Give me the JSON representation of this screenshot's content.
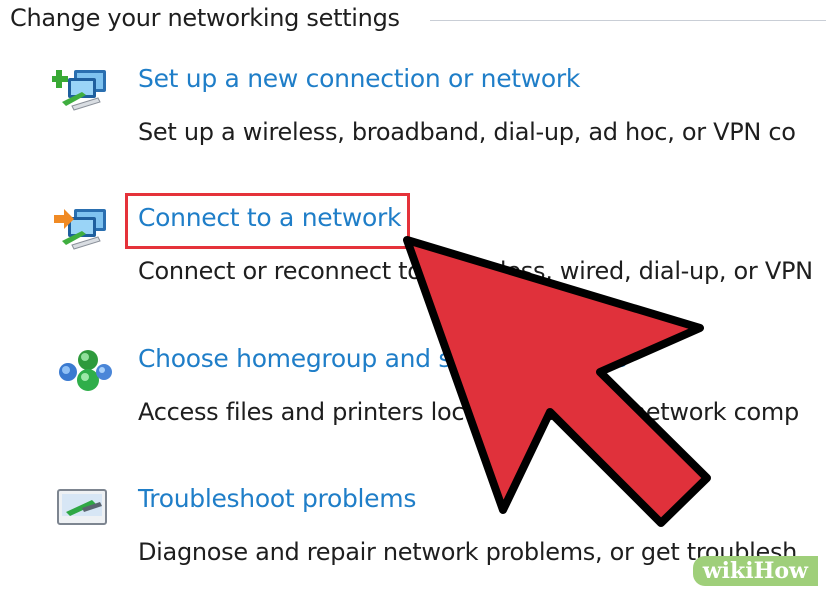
{
  "section": {
    "title": "Change your networking settings"
  },
  "tasks": [
    {
      "link": "Set up a new connection or network",
      "desc": "Set up a wireless, broadband, dial-up, ad hoc, or VPN co",
      "icon": "new-connection-icon"
    },
    {
      "link": "Connect to a network",
      "desc": "Connect or reconnect to a wireless, wired, dial-up, or VPN",
      "icon": "connect-network-icon"
    },
    {
      "link": "Choose homegroup and sharing options",
      "desc": "Access files and printers located on other network comp",
      "icon": "homegroup-icon"
    },
    {
      "link": "Troubleshoot problems",
      "desc": "Diagnose and repair network problems, or get troublesh",
      "icon": "troubleshoot-icon"
    }
  ],
  "overlay": {
    "arrow_color": "#e0313b",
    "highlight_color": "#e5323a",
    "highlighted_task": "Connect to a network"
  },
  "watermark": {
    "text_a": "wiki",
    "text_b": "How"
  }
}
